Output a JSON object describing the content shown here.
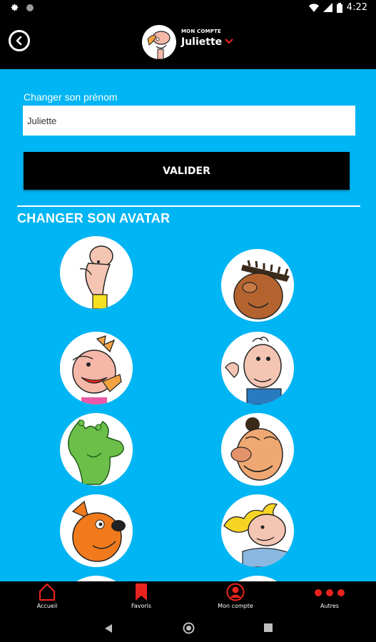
{
  "status_bar": {
    "time": "4:22"
  },
  "header": {
    "subtitle": "MON COMPTE",
    "name": "Juliette"
  },
  "form": {
    "label": "Changer son prénom",
    "input_value": "Juliette",
    "validate_label": "VALIDER"
  },
  "avatars_section": {
    "title": "CHANGER SON AVATAR"
  },
  "bottom_nav": {
    "items": [
      {
        "label": "Accueil",
        "icon": "home-icon"
      },
      {
        "label": "Favoris",
        "icon": "bookmark-icon"
      },
      {
        "label": "Mon compte",
        "icon": "account-icon"
      },
      {
        "label": "Autres",
        "icon": "more-dots-icon"
      }
    ]
  },
  "colors": {
    "background": "#00b5f3",
    "accent": "#e8231e",
    "bar": "#000000"
  }
}
